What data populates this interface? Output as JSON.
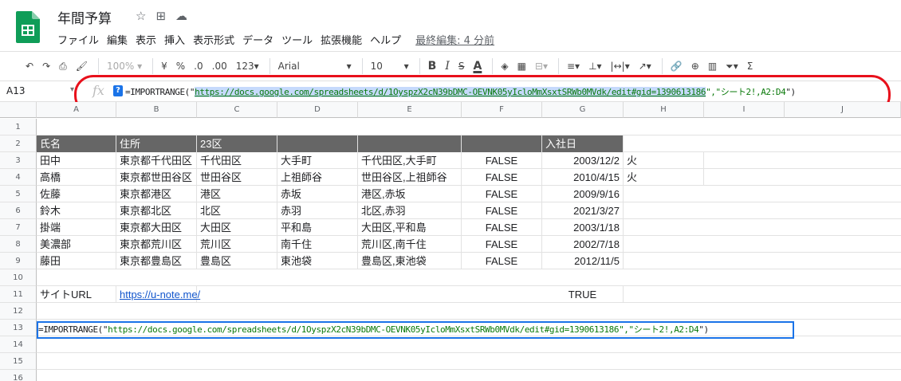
{
  "app": {
    "title": "年間予算",
    "menu": [
      "ファイル",
      "編集",
      "表示",
      "挿入",
      "表示形式",
      "データ",
      "ツール",
      "拡張機能",
      "ヘルプ"
    ],
    "last_edit": "最終編集: 4 分前"
  },
  "toolbar": {
    "zoom": "100%",
    "currency": "¥",
    "percent": "%",
    "dec_less": ".0",
    "dec_more": ".00",
    "format_more": "123",
    "font": "Arial",
    "font_size": "10",
    "bold": "B",
    "italic": "I",
    "strike": "S",
    "text_color": "A"
  },
  "formula_bar": {
    "name_box": "A13",
    "fx": "fx",
    "help": "?",
    "prefix": "=IMPORTRANGE(\"",
    "url": "https://docs.google.com/spreadsheets/d/1OyspzX2cN39bDMC-OEVNK05yIcloMmXsxtSRWb0MVdk/edit#gid=1390613186",
    "mid": "\",\"",
    "range": "シート2!,A2:D4",
    "suffix": "\")"
  },
  "columns": [
    "A",
    "B",
    "C",
    "D",
    "E",
    "F",
    "G",
    "H",
    "I",
    "J"
  ],
  "rows": [
    "1",
    "2",
    "3",
    "4",
    "5",
    "6",
    "7",
    "8",
    "9",
    "10",
    "11",
    "12",
    "13",
    "14",
    "15",
    "16"
  ],
  "table": {
    "header": [
      "氏名",
      "住所",
      "23区",
      "",
      "",
      "",
      "入社日"
    ],
    "data": [
      [
        "田中",
        "東京都千代田区",
        "千代田区",
        "大手町",
        "千代田区,大手町",
        "FALSE",
        "2003/12/2",
        "火"
      ],
      [
        "高橋",
        "東京都世田谷区",
        "世田谷区",
        "上祖師谷",
        "世田谷区,上祖師谷",
        "FALSE",
        "2010/4/15",
        "火"
      ],
      [
        "佐藤",
        "東京都港区",
        "港区",
        "赤坂",
        "港区,赤坂",
        "FALSE",
        "2009/9/16",
        ""
      ],
      [
        "鈴木",
        "東京都北区",
        "北区",
        "赤羽",
        "北区,赤羽",
        "FALSE",
        "2021/3/27",
        ""
      ],
      [
        "掛端",
        "東京都大田区",
        "大田区",
        "平和島",
        "大田区,平和島",
        "FALSE",
        "2003/1/18",
        ""
      ],
      [
        "美濃部",
        "東京都荒川区",
        "荒川区",
        "南千住",
        "荒川区,南千住",
        "FALSE",
        "2002/7/18",
        ""
      ],
      [
        "藤田",
        "東京都豊島区",
        "豊島区",
        "東池袋",
        "豊島区,東池袋",
        "FALSE",
        "2012/11/5",
        ""
      ]
    ]
  },
  "row11": {
    "label": "サイトURL",
    "link": "https://u-note.me/",
    "value": "TRUE"
  },
  "row13": {
    "prefix": "=IMPORTRANGE(\"",
    "url": "https://docs.google.com/spreadsheets/d/1OyspzX2cN39bDMC-OEVNK05yIcloMmXsxtSRWb0MVdk/edit#gid=1390613186",
    "mid": "\",\"",
    "range": "シート2!,A2:D4",
    "suffix": "\")"
  },
  "colors": {
    "annotation": "#e8101b",
    "selection": "#1a73e8",
    "header_fill": "#666666",
    "string_green": "#0b7a0b"
  }
}
